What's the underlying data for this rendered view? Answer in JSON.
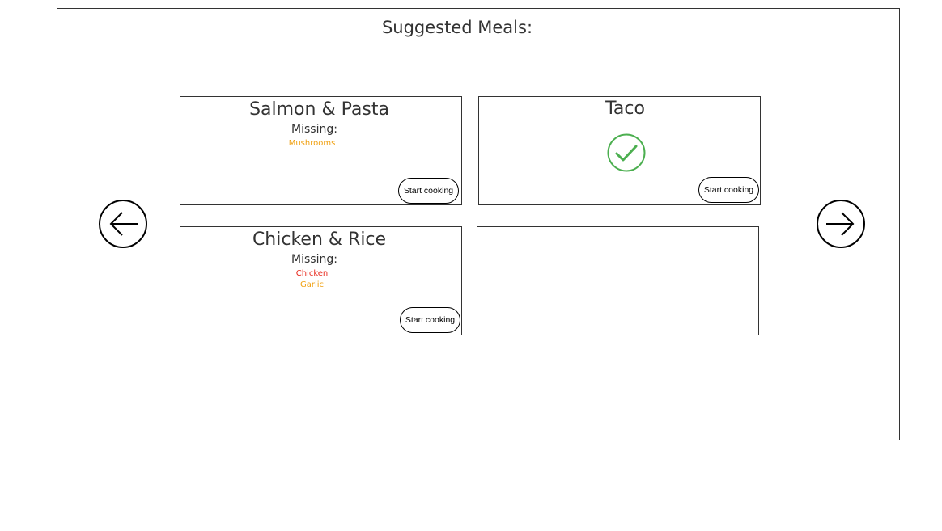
{
  "page": {
    "title": "Suggested Meals:"
  },
  "navigation": {
    "prev_icon": "arrow-left-icon",
    "next_icon": "arrow-right-icon"
  },
  "meals": [
    {
      "name": "Salmon & Pasta",
      "missing_label": "Missing:",
      "missing": [
        {
          "name": "Mushrooms",
          "color": "#f0a010"
        }
      ],
      "button_label": "Start cooking"
    },
    {
      "name": "Taco",
      "status_icon": "check-circle-icon",
      "status_color": "#4caf50",
      "button_label": "Start cooking"
    },
    {
      "name": "Chicken & Rice",
      "missing_label": "Missing:",
      "missing": [
        {
          "name": "Chicken",
          "color": "#e8281c"
        },
        {
          "name": "Garlic",
          "color": "#f0a010"
        }
      ],
      "button_label": "Start cooking"
    }
  ]
}
